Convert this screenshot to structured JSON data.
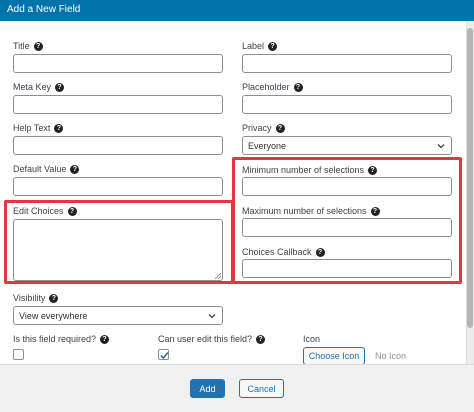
{
  "dialog": {
    "title": "Add a New Field"
  },
  "fields": {
    "title": {
      "label": "Title",
      "value": ""
    },
    "meta_key": {
      "label": "Meta Key",
      "value": ""
    },
    "help_text": {
      "label": "Help Text",
      "value": ""
    },
    "default_value": {
      "label": "Default Value",
      "value": ""
    },
    "edit_choices": {
      "label": "Edit Choices",
      "value": ""
    },
    "label": {
      "label": "Label",
      "value": ""
    },
    "placeholder": {
      "label": "Placeholder",
      "value": ""
    },
    "privacy": {
      "label": "Privacy",
      "selected": "Everyone"
    },
    "min_selections": {
      "label": "Minimum number of selections",
      "value": ""
    },
    "max_selections": {
      "label": "Maximum number of selections",
      "value": ""
    },
    "choices_callback": {
      "label": "Choices Callback",
      "value": ""
    },
    "visibility": {
      "label": "Visibility",
      "selected": "View everywhere"
    },
    "required": {
      "label": "Is this field required?",
      "checked": false
    },
    "user_edit": {
      "label": "Can user edit this field?",
      "checked": true
    },
    "icon": {
      "label": "Icon",
      "button": "Choose Icon",
      "status": "No Icon"
    }
  },
  "footer": {
    "add_label": "Add",
    "cancel_label": "Cancel"
  },
  "colors": {
    "titlebar": "#0073aa",
    "primary": "#2271b1",
    "highlight": "#e0383e"
  },
  "help_icon_glyph": "?"
}
